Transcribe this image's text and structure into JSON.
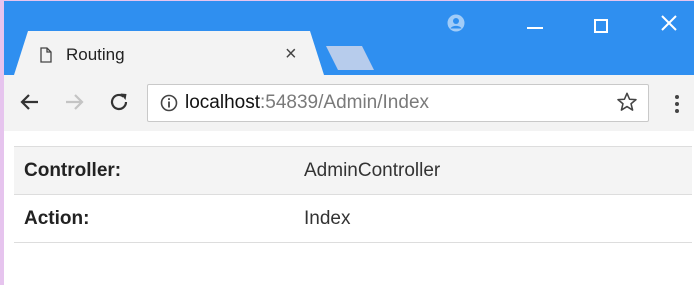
{
  "browser": {
    "tab": {
      "title": "Routing",
      "close_glyph": "×"
    },
    "address_bar": {
      "host": "localhost",
      "rest": ":54839/Admin/Index"
    },
    "icons": {
      "page": "page-icon",
      "profile": "profile-icon",
      "minimize": "minimize-icon",
      "maximize": "maximize-icon",
      "close": "close-icon",
      "back": "back-arrow-icon",
      "forward": "forward-arrow-icon",
      "reload": "reload-icon",
      "info": "info-icon",
      "star": "star-icon",
      "menu": "kebab-menu-icon"
    },
    "colors": {
      "titlebar": "#2f8ff0",
      "tab": "#f3f3f3",
      "toolbar": "#f3f3f3"
    }
  },
  "page": {
    "rows": [
      {
        "label": "Controller:",
        "value": "AdminController"
      },
      {
        "label": "Action:",
        "value": "Index"
      }
    ]
  }
}
